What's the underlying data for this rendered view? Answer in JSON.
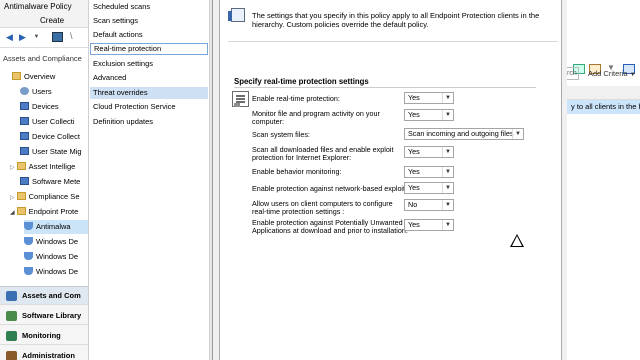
{
  "console": {
    "ribbon_tab": "Antimalware Policy",
    "ribbon_group": "Create",
    "workspace_title": "Assets and Compliance",
    "tree": [
      {
        "label": "Overview",
        "icon": "folder-icon"
      },
      {
        "label": "Users",
        "icon": "user-icon"
      },
      {
        "label": "Devices",
        "icon": "device-icon"
      },
      {
        "label": "User Collecti",
        "icon": "collection-icon"
      },
      {
        "label": "Device Collect",
        "icon": "collection-icon"
      },
      {
        "label": "User State Mig",
        "icon": "migration-icon"
      },
      {
        "label": "Asset Intellige",
        "icon": "folder-icon"
      },
      {
        "label": "Software Mete",
        "icon": "metering-icon"
      },
      {
        "label": "Compliance Se",
        "icon": "folder-icon"
      },
      {
        "label": "Endpoint Prote",
        "icon": "folder-icon"
      },
      {
        "label": "Antimalwa",
        "icon": "shield-icon"
      },
      {
        "label": "Windows De",
        "icon": "shield-icon"
      },
      {
        "label": "Windows De",
        "icon": "shield-icon"
      },
      {
        "label": "Windows De",
        "icon": "shield-icon"
      }
    ],
    "workspaces": [
      {
        "label": "Assets and Com",
        "icon": "assets-icon",
        "active": true
      },
      {
        "label": "Software Library",
        "icon": "library-icon",
        "active": false
      },
      {
        "label": "Monitoring",
        "icon": "monitoring-icon",
        "active": false
      },
      {
        "label": "Administration",
        "icon": "administration-icon",
        "active": false
      }
    ],
    "right_search_fragment": "rch",
    "right_add_criteria": "Add Criteria",
    "right_row_fragment": "y to all clients in the hie"
  },
  "dialog": {
    "pages": [
      "Scheduled scans",
      "Scan settings",
      "Default actions",
      "Real-time protection",
      "Exclusion settings",
      "Advanced",
      "Threat overrides",
      "Cloud Protection Service",
      "Definition updates"
    ],
    "focused_page": "Real-time protection",
    "selected_page": "Threat overrides",
    "info_text": "The settings that you specify in this policy apply to all Endpoint Protection clients in the hierarchy. Custom policies override the default policy.",
    "section_heading": "Specify real-time protection settings",
    "settings": [
      {
        "label": "Enable real-time protection:",
        "value": "Yes"
      },
      {
        "label": "Monitor file and program activity on your computer:",
        "value": "Yes"
      },
      {
        "label": "Scan system files:",
        "value": "Scan incoming and outgoing files"
      },
      {
        "label": "Scan all downloaded files and enable exploit protection for Internet Explorer:",
        "value": "Yes"
      },
      {
        "label": "Enable behavior monitoring:",
        "value": "Yes"
      },
      {
        "label": "Enable protection against network-based exploits:",
        "value": "Yes"
      },
      {
        "label": "Allow users on client computers to configure real-time protection settings :",
        "value": "No"
      },
      {
        "label": "Enable protection against Potentially Unwanted Applications at download and prior to installation:",
        "value": "Yes"
      }
    ]
  }
}
